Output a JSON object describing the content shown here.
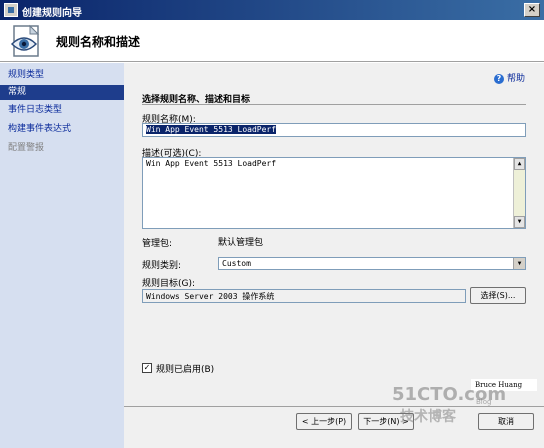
{
  "window": {
    "title": "创建规则向导",
    "close_glyph": "×"
  },
  "header": {
    "title": "规则名称和描述"
  },
  "sidebar": {
    "items": [
      {
        "label": "规则类型",
        "state": "normal"
      },
      {
        "label": "常规",
        "state": "active"
      },
      {
        "label": "事件日志类型",
        "state": "normal"
      },
      {
        "label": "构建事件表达式",
        "state": "normal"
      },
      {
        "label": "配置警报",
        "state": "disabled"
      }
    ]
  },
  "main": {
    "help_label": "帮助",
    "section_title": "选择规则名称、描述和目标",
    "rule_name": {
      "label": "规则名称(M):",
      "value": "Win App Event 5513 LoadPerf"
    },
    "description": {
      "label": "描述(可选)(C):",
      "value": "Win App Event 5513 LoadPerf"
    },
    "management_pack": {
      "label": "管理包:",
      "value": "默认管理包"
    },
    "rule_category": {
      "label": "规则类别:",
      "value": "Custom"
    },
    "rule_target": {
      "label": "规则目标(G):",
      "value": "Windows Server 2003 操作系统",
      "select_button": "选择(S)..."
    },
    "enabled": {
      "label": "规则已启用(B)",
      "checked": true,
      "check_glyph": "✓"
    }
  },
  "footer": {
    "back_button": "< 上一步(P)",
    "next_button": "下一步(N) >",
    "cancel_button": "取消"
  },
  "overlay": {
    "credit": "Bruce Huang",
    "watermark": "51CTO.com",
    "watermark_sub": "技术博客",
    "watermark_tag": "Blog"
  },
  "colors": {
    "sidebar_bg": "#d6dff0",
    "active_item": "#1e3d8c",
    "link": "#0b2b9b",
    "titlebar": "#0a246a"
  }
}
